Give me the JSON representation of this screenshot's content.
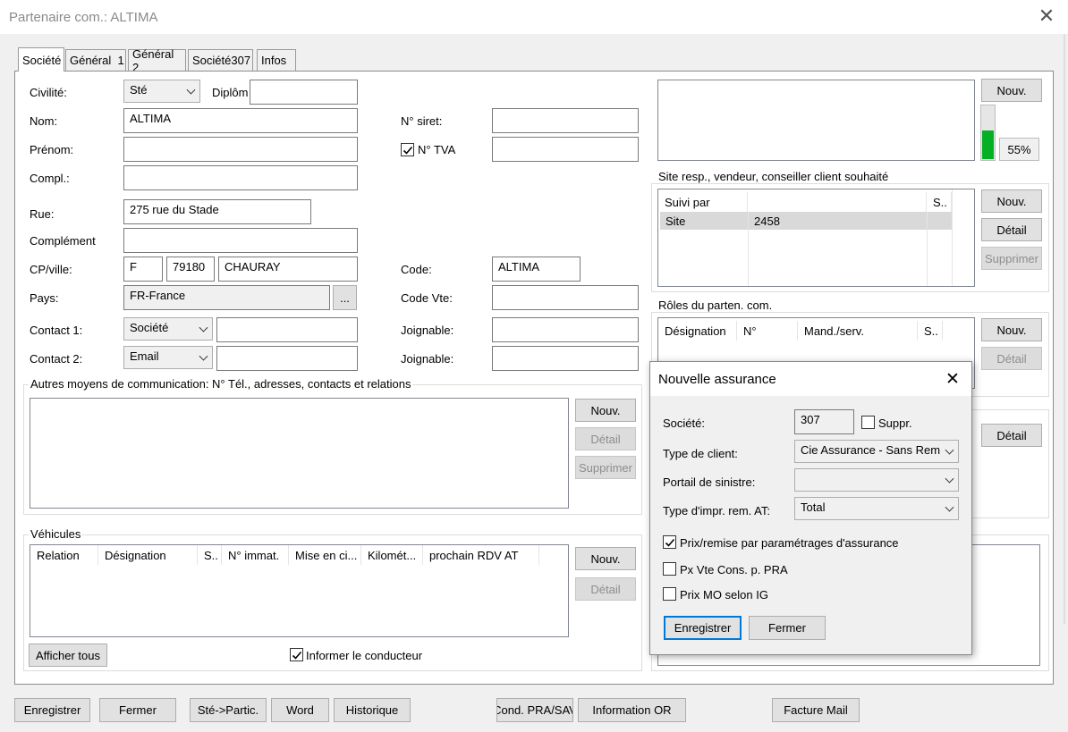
{
  "window": {
    "title": "Partenaire com.: ALTIMA",
    "close_glyph": "✕"
  },
  "tabs": [
    {
      "label": "Société",
      "active": true
    },
    {
      "label": "Général  1"
    },
    {
      "label": "Général 2"
    },
    {
      "label": "Société307"
    },
    {
      "label": "Infos"
    }
  ],
  "form": {
    "civilite_label": "Civilité:",
    "civilite_value": "Sté",
    "diplom_label": "Diplôm",
    "diplom_value": "",
    "nom_label": "Nom:",
    "nom_value": "ALTIMA",
    "prenom_label": "Prénom:",
    "prenom_value": "",
    "compl_label": "Compl.:",
    "compl_value": "",
    "rue_label": "Rue:",
    "rue_value": "275 rue du Stade",
    "complement_label": "Complément",
    "complement_value": "",
    "cpville_label": "CP/ville:",
    "country_code": "F",
    "cp_value": "79180",
    "ville_value": "CHAURAY",
    "pays_label": "Pays:",
    "pays_value": "FR-France",
    "pays_button": "...",
    "contact1_label": "Contact 1:",
    "contact1_type": "Société",
    "contact1_value": "",
    "contact2_label": "Contact 2:",
    "contact2_type": "Email",
    "contact2_value": "",
    "siret_label": "N° siret:",
    "siret_value": "",
    "tva_label": "N° TVA",
    "tva_checked": true,
    "tva_value": "",
    "code_label": "Code:",
    "code_value": "ALTIMA",
    "codevte_label": "Code Vte:",
    "codevte_value": "",
    "joignable1_label": "Joignable:",
    "joignable1_value": "",
    "joignable2_label": "Joignable:",
    "joignable2_value": ""
  },
  "autres": {
    "title": "Autres moyens de communication: N° Tél., adresses, contacts et relations",
    "nouv": "Nouv.",
    "detail": "Détail",
    "supprimer": "Supprimer"
  },
  "vehicules": {
    "title": "Véhicules",
    "columns": [
      "Relation",
      "Désignation",
      "S..",
      "N° immat.",
      "Mise en ci...",
      "Kilomét...",
      "prochain RDV AT"
    ],
    "nouv": "Nouv.",
    "detail": "Détail",
    "afficher_tous": "Afficher tous",
    "informer_label": "Informer le conducteur",
    "informer_checked": true
  },
  "right": {
    "nouv": "Nouv.",
    "progress_percent": 55,
    "progress_label": "55%",
    "progress_color": "#06b025",
    "site_title": "Site resp., vendeur, conseiller client souhaité",
    "site_columns": [
      "Suivi par",
      "",
      "S.."
    ],
    "site_rows": [
      {
        "suivi": "Site",
        "value": "2458"
      }
    ],
    "site_nouv": "Nouv.",
    "site_detail": "Détail",
    "site_supprimer": "Supprimer",
    "roles_title": "Rôles du parten. com.",
    "roles_columns": [
      "Désignation",
      "N°",
      "Mand./serv.",
      "S.."
    ],
    "roles_nouv": "Nouv.",
    "roles_detail": "Détail",
    "group3_detail": "Détail"
  },
  "bottom_buttons": [
    "Enregistrer",
    "Fermer",
    "Sté->Partic.",
    "Word",
    "Historique",
    "Cond. PRA/SAV",
    "Information OR",
    "Facture Mail"
  ],
  "dialog": {
    "title": "Nouvelle assurance",
    "societe_label": "Société:",
    "societe_value": "307",
    "suppr_label": "Suppr.",
    "suppr_checked": false,
    "type_client_label": "Type de client:",
    "type_client_value": "Cie Assurance - Sans Rem",
    "portail_label": "Portail de sinistre:",
    "portail_value": "",
    "type_impr_label": "Type d'impr. rem. AT:",
    "type_impr_value": "Total",
    "chk_prix_remise": {
      "label": "Prix/remise par paramétrages d'assurance",
      "checked": true
    },
    "chk_px_vte": {
      "label": "Px Vte Cons. p. PRA",
      "checked": false
    },
    "chk_prix_mo": {
      "label": "Prix MO selon IG",
      "checked": false
    },
    "save": "Enregistrer",
    "close": "Fermer"
  }
}
